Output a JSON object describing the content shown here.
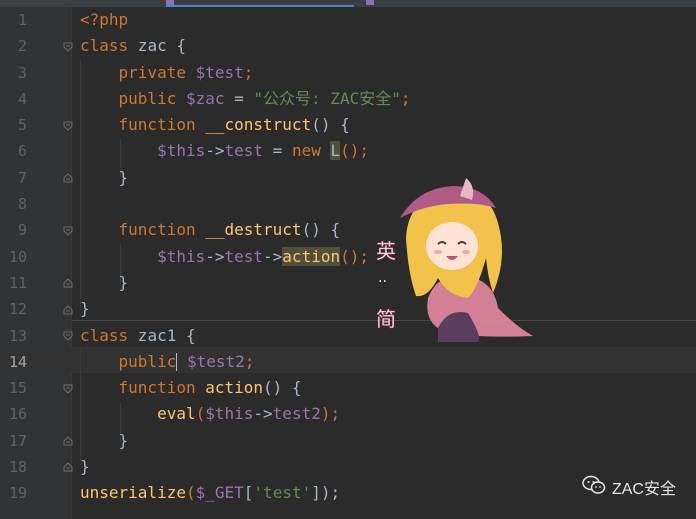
{
  "editor": {
    "line_numbers": [
      "1",
      "2",
      "3",
      "4",
      "5",
      "6",
      "7",
      "8",
      "9",
      "10",
      "11",
      "12",
      "13",
      "14",
      "15",
      "16",
      "17",
      "18",
      "19"
    ],
    "active_line": "14"
  },
  "code": {
    "l1": "<?php",
    "l2_kw": "class",
    "l2_rest": " zac {",
    "l3_kw": "private",
    "l3_var": "$test",
    "l3_end": ";",
    "l4_kw": "public",
    "l4_var": "$zac",
    "l4_eq": " = ",
    "l4_str": "\"公众号: ZAC安全\"",
    "l4_end": ";",
    "l5_kw": "function",
    "l5_fn": "__construct",
    "l5_end": "() {",
    "l6_var": "$this",
    "l6_arrow": "->",
    "l6_prop": "test",
    "l6_eq": " = ",
    "l6_new": "new",
    "l6_cls": "L",
    "l6_end": "();",
    "l7": "}",
    "l9_kw": "function",
    "l9_fn": "__destruct",
    "l9_end": "() {",
    "l10_var": "$this",
    "l10_arrow": "->",
    "l10_prop": "test",
    "l10_arrow2": "->",
    "l10_method": "action",
    "l10_end": "();",
    "l11": "}",
    "l12": "}",
    "l13_kw": "class",
    "l13_rest": " zac1 {",
    "l14_kw": "public",
    "l14_var": "$test2",
    "l14_end": ";",
    "l15_kw": "function",
    "l15_fn": "action",
    "l15_end": "() {",
    "l16_fn": "eval",
    "l16_open": "(",
    "l16_var": "$this",
    "l16_arrow": "->",
    "l16_prop": "test2",
    "l16_end": ");",
    "l17": "}",
    "l18": "}",
    "l19_fn": "unserialize",
    "l19_open": "(",
    "l19_var": "$_GET",
    "l19_br": "[",
    "l19_str": "'test'",
    "l19_end": "]);"
  },
  "watermark": {
    "text": "ZAC安全",
    "icon": "wechat-icon"
  },
  "sticker": {
    "icon": "anime-girl-sticker"
  }
}
